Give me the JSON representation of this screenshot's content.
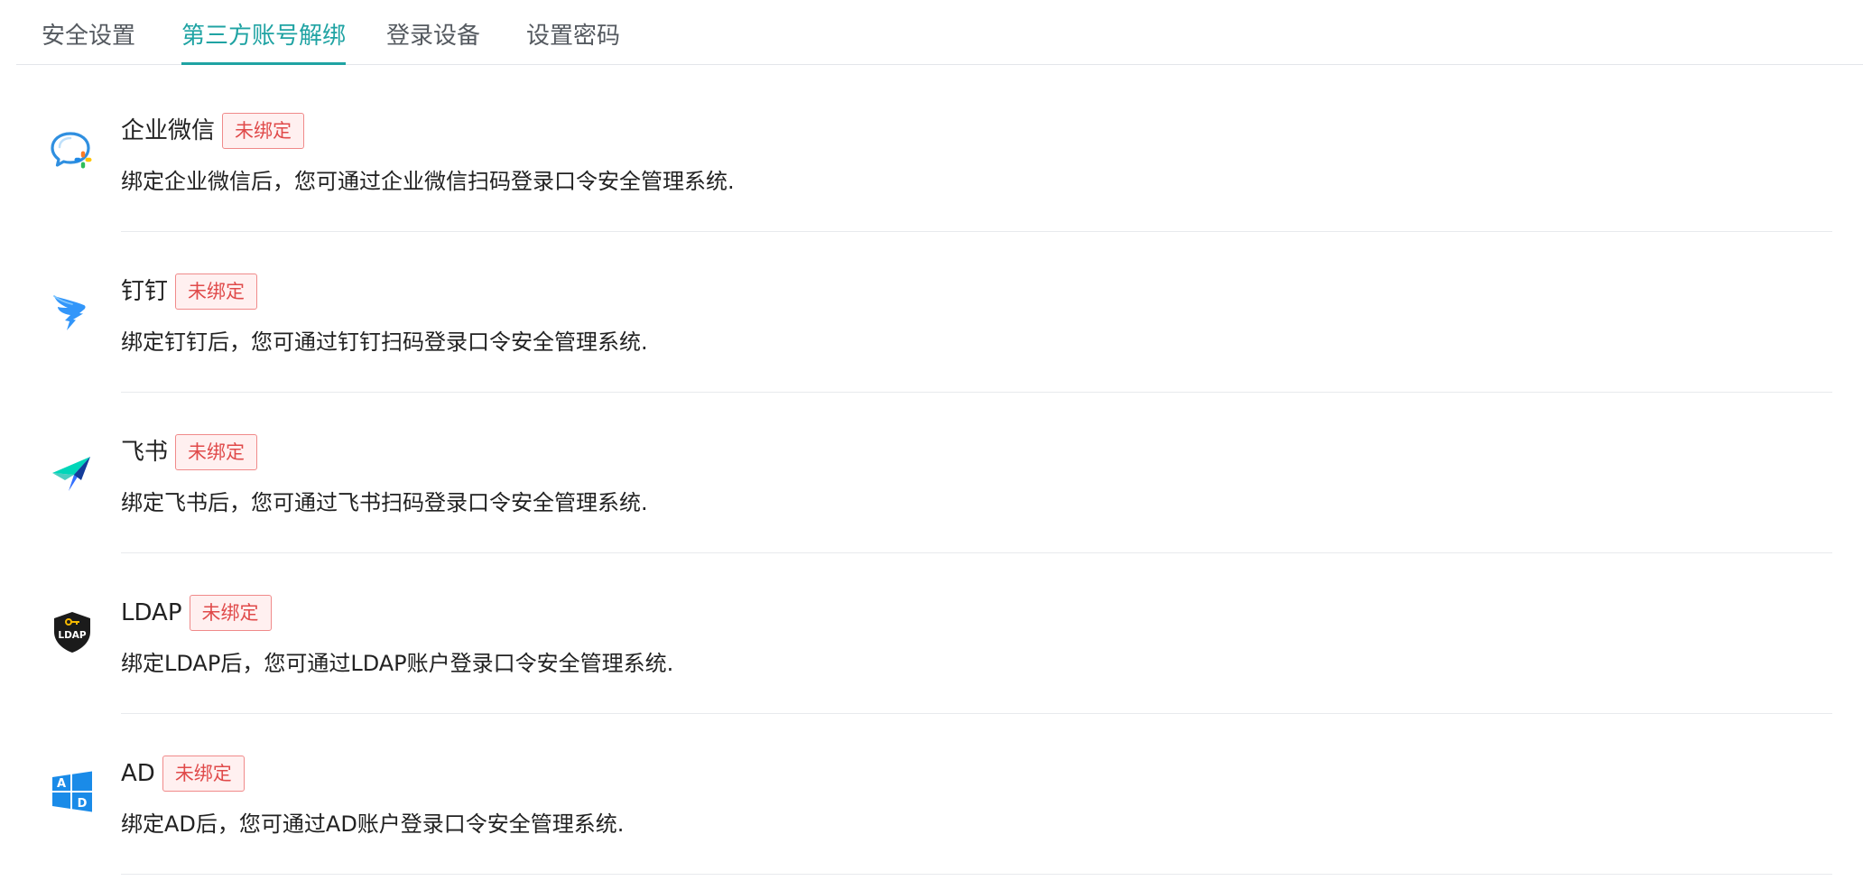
{
  "tabs": [
    {
      "label": "安全设置",
      "active": false
    },
    {
      "label": "第三方账号解绑",
      "active": true
    },
    {
      "label": "登录设备",
      "active": false
    },
    {
      "label": "设置密码",
      "active": false
    }
  ],
  "accounts": [
    {
      "name": "企业微信",
      "status": "未绑定",
      "description": "绑定企业微信后，您可通过企业微信扫码登录口令安全管理系统.",
      "icon": "wecom-icon"
    },
    {
      "name": "钉钉",
      "status": "未绑定",
      "description": "绑定钉钉后，您可通过钉钉扫码登录口令安全管理系统.",
      "icon": "dingtalk-icon"
    },
    {
      "name": "飞书",
      "status": "未绑定",
      "description": "绑定飞书后，您可通过飞书扫码登录口令安全管理系统.",
      "icon": "feishu-icon"
    },
    {
      "name": "LDAP",
      "status": "未绑定",
      "description": "绑定LDAP后，您可通过LDAP账户登录口令安全管理系统.",
      "icon": "ldap-icon",
      "icon_text": "LDAP"
    },
    {
      "name": "AD",
      "status": "未绑定",
      "description": "绑定AD后，您可通过AD账户登录口令安全管理系统.",
      "icon": "ad-icon",
      "icon_text": [
        "A",
        "D"
      ]
    }
  ],
  "colors": {
    "accent": "#1fa3a3",
    "badge_text": "#e04a4a",
    "badge_border": "#f08a8a",
    "badge_bg": "#fff0f0"
  }
}
